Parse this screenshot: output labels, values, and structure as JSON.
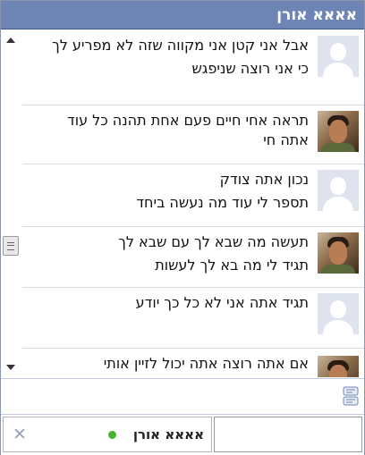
{
  "chat": {
    "title": "אאאא אורן",
    "messages": [
      {
        "avatar": "generic-user-icon",
        "lines": [
          "אבל אני קטן אני מקווה שזה לא מפריע לך",
          "כי אני רוצה שניפגש"
        ]
      },
      {
        "avatar": "user-photo",
        "lines": [
          "תראה אחי חיים פעם אחת תהנה כל עוד אתה חי"
        ]
      },
      {
        "avatar": "generic-user-icon",
        "lines": [
          "נכון אתה צודק",
          "תספר לי עוד מה נעשה ביחד"
        ]
      },
      {
        "avatar": "user-photo",
        "lines": [
          "תעשה מה שבא לך עם שבא לך",
          "תגיד לי מה בא לך לעשות"
        ]
      },
      {
        "avatar": "generic-user-icon",
        "lines": [
          "תגיד אתה אני לא כל כך יודע"
        ]
      },
      {
        "avatar": "user-photo",
        "lines": [
          "אם אתה רוצה אתה יכול לזיין אותי"
        ]
      }
    ],
    "tab": {
      "name": "אאאא אורן",
      "status_color": "#42b72a",
      "close_label": "✕"
    },
    "icons": {
      "compose": "compose-icon",
      "scroll_up": "scroll-up-arrow",
      "scroll_down": "scroll-down-arrow"
    }
  }
}
